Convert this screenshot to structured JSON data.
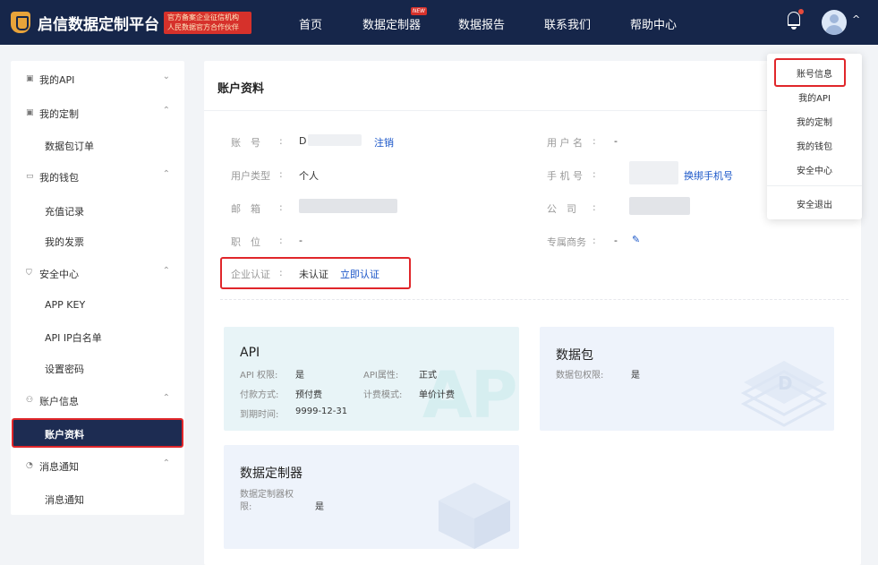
{
  "header": {
    "brand": "启信数据定制平台",
    "badge_line1": "官方备案企业征信机构",
    "badge_line2": "人民数据官方合作伙伴",
    "nav": [
      "首页",
      "数据定制器",
      "数据报告",
      "联系我们",
      "帮助中心"
    ],
    "new_tag": "NEW",
    "caret": "^"
  },
  "sidebar": {
    "items": [
      {
        "label": "我的API",
        "icon": "API",
        "chevron": "v"
      },
      {
        "label": "我的定制",
        "icon": "API",
        "chevron": "^"
      },
      {
        "label": "数据包订单"
      },
      {
        "label": "我的钱包",
        "icon": "wallet-icon",
        "chevron": "^"
      },
      {
        "label": "充值记录"
      },
      {
        "label": "我的发票"
      },
      {
        "label": "安全中心",
        "icon": "shield-icon",
        "chevron": "^"
      },
      {
        "label": "APP KEY"
      },
      {
        "label": "API IP白名单"
      },
      {
        "label": "设置密码"
      },
      {
        "label": "账户信息",
        "icon": "user-icon",
        "chevron": "^"
      },
      {
        "label": "账户资料"
      },
      {
        "label": "消息通知",
        "icon": "bell-icon",
        "chevron": "^"
      },
      {
        "label": "消息通知"
      }
    ]
  },
  "main": {
    "title": "账户资料",
    "fields": {
      "account_label": "账　号",
      "account_value": "D",
      "account_link": "注销",
      "username_label": "用 户 名",
      "username_value": "-",
      "usertype_label": "用户类型",
      "usertype_value": "个人",
      "phone_label": "手 机 号",
      "phone_link": "换绑手机号",
      "email_label": "邮　箱",
      "company_label": "公　司",
      "position_label": "职　位",
      "position_value": "-",
      "manager_label": "专属商务",
      "manager_value": "-",
      "cert_label": "企业认证",
      "cert_value": "未认证",
      "cert_link": "立即认证",
      "colon": ":"
    },
    "cards": {
      "api": {
        "title": "API",
        "perm_label": "API 权限:",
        "perm_value": "是",
        "attr_label": "API属性:",
        "attr_value": "正式",
        "pay_label": "付款方式:",
        "pay_value": "预付费",
        "bill_label": "计费模式:",
        "bill_value": "单价计费",
        "expire_label": "到期时间:",
        "expire_value": "9999-12-31",
        "watermark": "API"
      },
      "package": {
        "title": "数据包",
        "perm_label": "数据包权限:",
        "perm_value": "是"
      },
      "customizer": {
        "title": "数据定制器",
        "perm_label_1": "数据定制器权",
        "perm_label_2": "限:",
        "perm_value": "是"
      }
    }
  },
  "dropdown": {
    "items": [
      "账号信息",
      "我的API",
      "我的定制",
      "我的钱包",
      "安全中心",
      "安全退出"
    ]
  },
  "colors": {
    "header_bg": "#16264a",
    "accent_blue": "#1a56c8",
    "highlight_red": "#e0262a",
    "active_bg": "#1d2c52"
  }
}
